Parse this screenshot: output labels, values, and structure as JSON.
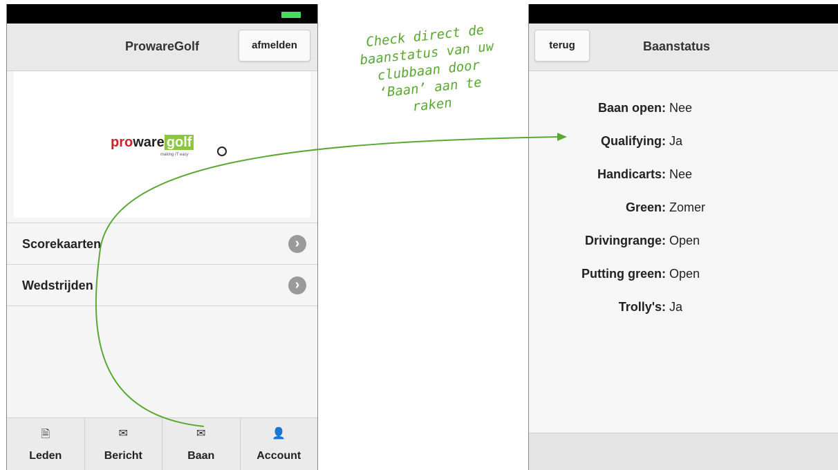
{
  "left_screen": {
    "header": {
      "title": "ProwareGolf",
      "logout_label": "afmelden"
    },
    "logo": {
      "pro": "pro",
      "ware": "ware",
      "golf": "golf",
      "tagline": "making IT easy"
    },
    "menu": [
      {
        "label": "Scorekaarten",
        "chevron": "›"
      },
      {
        "label": "Wedstrijden",
        "chevron": "›"
      }
    ],
    "tabs": [
      {
        "label": "Leden",
        "icon": "document-icon",
        "glyph": "🗎"
      },
      {
        "label": "Bericht",
        "icon": "envelope-icon",
        "glyph": "✉"
      },
      {
        "label": "Baan",
        "icon": "envelope-icon",
        "glyph": "✉"
      },
      {
        "label": "Account",
        "icon": "user-icon",
        "glyph": "👤"
      }
    ]
  },
  "annotation": {
    "lines": [
      "Check direct de",
      "baanstatus van uw",
      "clubbaan door",
      "‘Baan’ aan te",
      "raken"
    ],
    "color": "#5aa832"
  },
  "right_screen": {
    "header": {
      "back_label": "terug",
      "title": "Baanstatus"
    },
    "status": [
      {
        "key": "Baan open:",
        "value": "Nee"
      },
      {
        "key": "Qualifying:",
        "value": "Ja"
      },
      {
        "key": "Handicarts:",
        "value": "Nee"
      },
      {
        "key": "Green:",
        "value": "Zomer"
      },
      {
        "key": "Drivingrange:",
        "value": "Open"
      },
      {
        "key": "Putting green:",
        "value": "Open"
      },
      {
        "key": "Trolly's:",
        "value": "Ja"
      }
    ]
  },
  "colors": {
    "battery": "#4cd964",
    "brand_red": "#d31f2a",
    "brand_green": "#8cc63f"
  }
}
